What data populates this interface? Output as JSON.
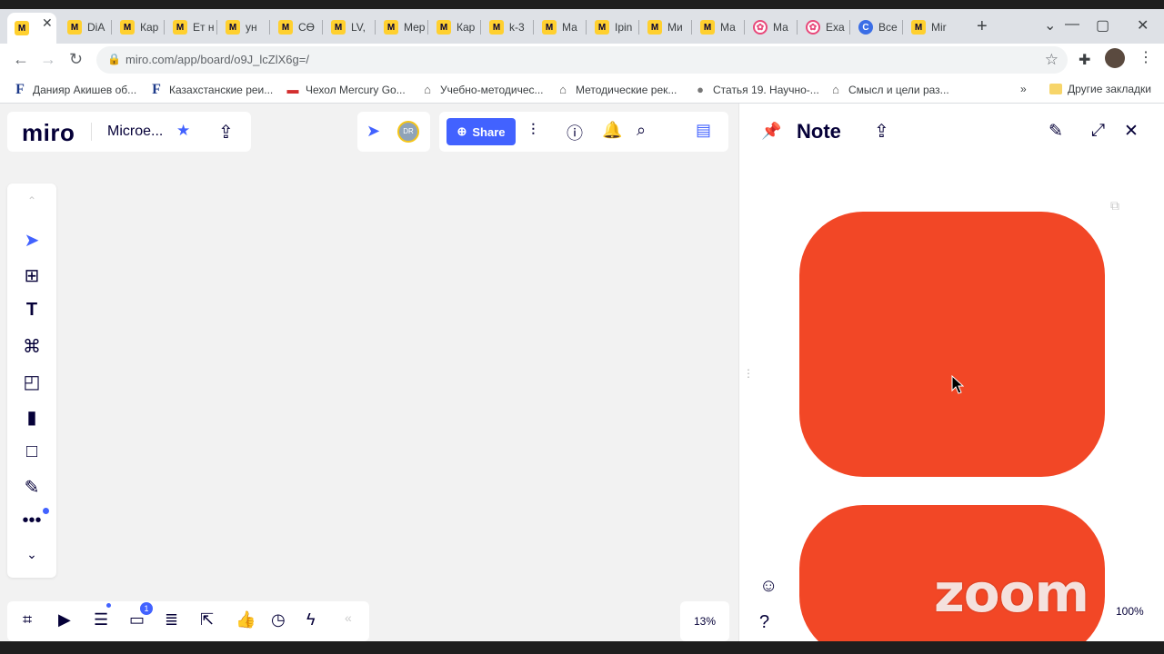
{
  "browser": {
    "tabs": [
      {
        "label": "",
        "icon": "miro",
        "active": true
      },
      {
        "label": "DiA",
        "icon": "miro"
      },
      {
        "label": "Кар",
        "icon": "miro"
      },
      {
        "label": "Ет н",
        "icon": "miro"
      },
      {
        "label": "ун",
        "icon": "miro"
      },
      {
        "label": "СӨ",
        "icon": "miro"
      },
      {
        "label": "LV,",
        "icon": "miro"
      },
      {
        "label": "Мер",
        "icon": "miro"
      },
      {
        "label": "Кар",
        "icon": "miro"
      },
      {
        "label": "k-3",
        "icon": "miro"
      },
      {
        "label": "Ма",
        "icon": "miro"
      },
      {
        "label": "Ipin",
        "icon": "miro"
      },
      {
        "label": "Ми",
        "icon": "miro"
      },
      {
        "label": "Ма",
        "icon": "miro"
      },
      {
        "label": "Ма",
        "icon": "pink"
      },
      {
        "label": "Exa",
        "icon": "pink"
      },
      {
        "label": "Все",
        "icon": "blue"
      },
      {
        "label": "Mir",
        "icon": "miro"
      }
    ],
    "new_tab": "+",
    "url": "miro.com/app/board/o9J_lcZlX6g=/",
    "bookmarks": [
      {
        "label": "Данияр Акишев об...",
        "icon": "F"
      },
      {
        "label": "Казахстанские реи...",
        "icon": "F"
      },
      {
        "label": "Чехол Mercury Go...",
        "icon": "▬"
      },
      {
        "label": "Учебно-методичес...",
        "icon": "⌂"
      },
      {
        "label": "Методические рек...",
        "icon": "⌂"
      },
      {
        "label": "Статья 19. Научно-...",
        "icon": "●"
      },
      {
        "label": "Смысл и цели раз...",
        "icon": "⌂"
      }
    ],
    "bookmarks_more": "»",
    "other_bookmarks": "Другие закладки"
  },
  "miro": {
    "logo": "miro",
    "board_name": "Microe...",
    "share_label": "Share",
    "avatar_initials": "DR",
    "zoom": "13%",
    "notification_count": "1"
  },
  "note_panel": {
    "title": "Note",
    "zoom": "100%",
    "card_color": "#f24726"
  },
  "overlay": {
    "watermark": "zoom"
  }
}
